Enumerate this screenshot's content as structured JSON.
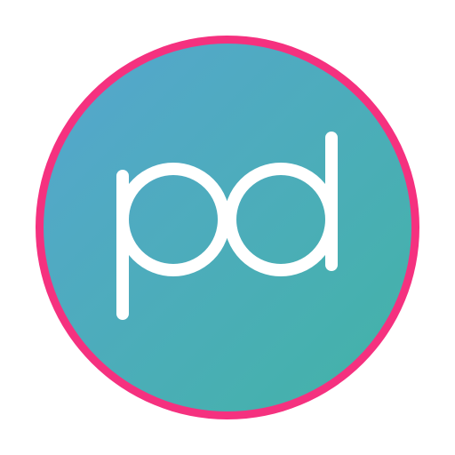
{
  "logo": {
    "text": "pd",
    "colors": {
      "ring": "#f5317f",
      "fill_start": "#56a6cf",
      "fill_end": "#42b3a6",
      "letters": "#ffffff",
      "background": "#ffffff"
    }
  }
}
